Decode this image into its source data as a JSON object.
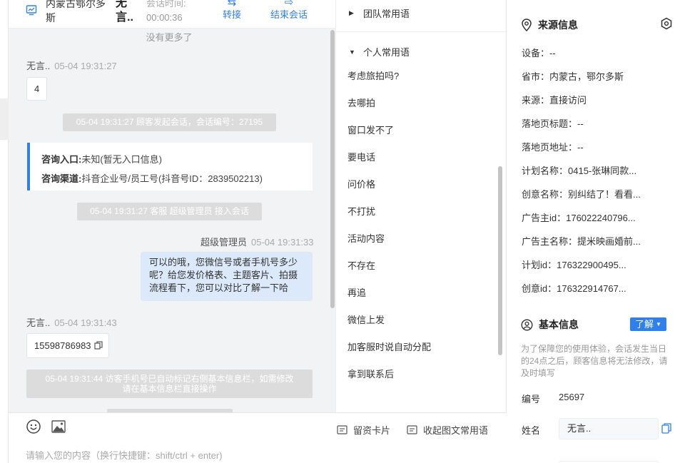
{
  "header": {
    "region": "内蒙古鄂尔多斯",
    "visitor_name": "无言..",
    "time_label": "会话时间:",
    "time_value": "00:00:36",
    "transfer_label": "转接",
    "end_label": "结束会话"
  },
  "messages": {
    "no_more": "没有更多了",
    "m1_sender": "无言..",
    "m1_time": "05-04 19:31:27",
    "m1_text": "4",
    "sys1": "05-04 19:31:27 顾客发起会话，会话编号：27195",
    "consult_entry_label": "咨询入口:",
    "consult_entry_value": "未知(暂无入口信息)",
    "consult_channel_label": "咨询渠道:",
    "consult_channel_value": "抖音企业号/员工号(抖音号ID：2839502213)",
    "sys2": "05-04 19:31:27 客服 超级管理员 接入会话",
    "m2_sender": "超级管理员",
    "m2_time": "05-04 19:31:33",
    "m2_text": "可以的哦，您微信号或者手机号多少呢？给您发价格表、主题客片、拍摄流程看下，您可以对比了解一下哈",
    "m3_sender": "无言..",
    "m3_time": "05-04 19:31:43",
    "m3_text": "15598786983",
    "sys3_line1": "05-04 19:31:44 访客手机号已自动标记右侧基本信息栏，如需修改",
    "sys3_line2": "请在基本信息栏直接操作"
  },
  "input": {
    "placeholder": "请输入您的内容（换行快捷键：shift/ctrl + enter)",
    "card_label": "留资卡片",
    "collapse_label": "收起图文常用语"
  },
  "phrases": {
    "team_group": "团队常用语",
    "personal_group": "个人常用语",
    "items": [
      "考虑旅拍吗?",
      "去哪拍",
      "窗口发不了",
      "要电话",
      "问价格",
      "不打扰",
      "活动内容",
      "不存在",
      "再追",
      "微信上发",
      "加客服时说自动分配",
      "拿到联系后"
    ]
  },
  "source_info": {
    "title": "来源信息",
    "rows": [
      "设备：--",
      "省市：内蒙古，鄂尔多斯",
      "来源：直接访问",
      "落地页标题：--",
      "落地页地址：--",
      "计划名称：0415-张琳同款...",
      "创意名称：别纠结了！看看...",
      "广告主id：176022240796...",
      "广告主名称：提米映画婚前...",
      "计划id：176322900495...",
      "创意id：176322914767..."
    ]
  },
  "basic_info": {
    "title": "基本信息",
    "learn_label": "了解",
    "notice": "为了保障您的使用体验，会话发生当日的24点之后，顾客信息将无法修改，请及时填写",
    "id_label": "编号",
    "id_value": "25697",
    "name_label": "姓名",
    "name_value": "无言.."
  },
  "colors": {
    "accent": "#2f80ed",
    "right_bubble": "#dce9fb",
    "chat_bg": "#f2f3f5",
    "system_pill": "#dcdcdc"
  }
}
